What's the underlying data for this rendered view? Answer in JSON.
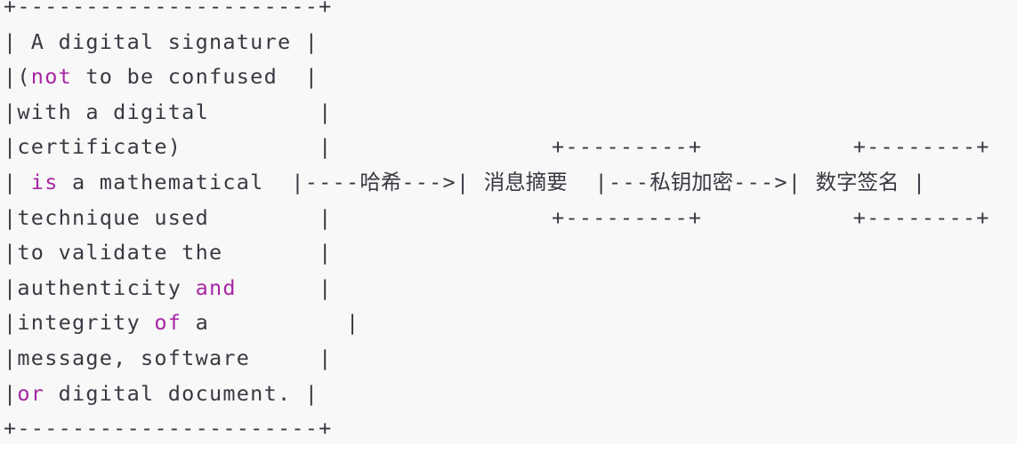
{
  "diagram": {
    "source_box": {
      "border_top": "+----------------------+",
      "border_bottom": "+----------------------+",
      "lines": [
        [
          {
            "t": "| A digital signature |"
          }
        ],
        [
          {
            "t": "|("
          },
          {
            "t": "not",
            "kw": true
          },
          {
            "t": " to be confused  |"
          }
        ],
        [
          {
            "t": "|with a digital        |"
          }
        ],
        [
          {
            "t": "|certificate)          |"
          }
        ],
        [
          {
            "t": "| "
          },
          {
            "t": "is",
            "kw": true
          },
          {
            "t": " a mathematical  |"
          }
        ],
        [
          {
            "t": "|technique used        |"
          }
        ],
        [
          {
            "t": "|to validate the       |"
          }
        ],
        [
          {
            "t": "|authenticity "
          },
          {
            "t": "and",
            "kw": true
          },
          {
            "t": "      |"
          }
        ],
        [
          {
            "t": "|integrity "
          },
          {
            "t": "of",
            "kw": true
          },
          {
            "t": " a          |"
          }
        ],
        [
          {
            "t": "|message, software     |"
          }
        ],
        [
          {
            "t": "|"
          },
          {
            "t": "or",
            "kw": true
          },
          {
            "t": " digital document. |"
          }
        ]
      ]
    },
    "arrow_row_index": 4,
    "box_top_row_index": 3,
    "box_bottom_row_index": 5,
    "arrow1": {
      "prefix": "----",
      "label": "哈希",
      "suffix": "--->"
    },
    "box1": {
      "label": "消息摘要",
      "top": "+---------+",
      "bottom": "+---------+"
    },
    "arrow2": {
      "prefix": "---",
      "label": "私钥加密",
      "suffix": "--->"
    },
    "box2": {
      "label": "数字签名",
      "top": "+--------+",
      "bottom": "+--------+"
    },
    "colors": {
      "background": "#f8f8f8",
      "text": "#383a42",
      "keyword": "#a626a4"
    }
  }
}
